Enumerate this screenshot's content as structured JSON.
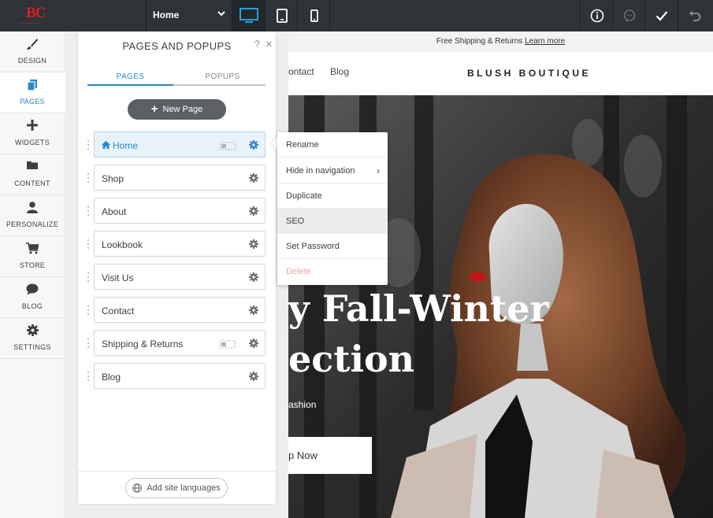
{
  "topbar": {
    "logo_text": "BC",
    "logo_sub": "BUSINESS",
    "page_selector": "Home",
    "devices": [
      "desktop-icon",
      "tablet-icon",
      "mobile-icon"
    ],
    "tools": [
      "info-icon",
      "chat-icon",
      "check-icon",
      "undo-icon"
    ]
  },
  "leftnav": {
    "items": [
      {
        "label": "DESIGN",
        "icon": "brush-icon"
      },
      {
        "label": "PAGES",
        "icon": "pages-icon"
      },
      {
        "label": "WIDGETS",
        "icon": "plus-icon"
      },
      {
        "label": "CONTENT",
        "icon": "folder-icon"
      },
      {
        "label": "PERSONALIZE",
        "icon": "person-icon"
      },
      {
        "label": "STORE",
        "icon": "cart-icon"
      },
      {
        "label": "BLOG",
        "icon": "chat-bubble-icon"
      },
      {
        "label": "SETTINGS",
        "icon": "gear-icon"
      }
    ],
    "active": "PAGES"
  },
  "panel": {
    "title": "PAGES AND POPUPS",
    "help": "?",
    "close": "×",
    "tabs": [
      {
        "label": "PAGES"
      },
      {
        "label": "POPUPS"
      }
    ],
    "new_page": "New Page",
    "pages": [
      {
        "name": "Home",
        "selected": true,
        "hidden_in_nav": true
      },
      {
        "name": "Shop"
      },
      {
        "name": "About"
      },
      {
        "name": "Lookbook"
      },
      {
        "name": "Visit Us"
      },
      {
        "name": "Contact"
      },
      {
        "name": "Shipping & Returns",
        "hidden_in_nav": true
      },
      {
        "name": "Blog"
      }
    ],
    "add_languages": "Add site languages"
  },
  "context_menu": {
    "items": [
      {
        "label": "Rename"
      },
      {
        "label": "Hide in navigation",
        "submenu": true
      },
      {
        "label": "Duplicate"
      },
      {
        "label": "SEO",
        "highlighted": true
      },
      {
        "label": "Set Password"
      },
      {
        "label": "Delete",
        "danger": true
      }
    ]
  },
  "site": {
    "promo_text": "Free Shipping & Returns",
    "promo_link": "Learn more",
    "nav": [
      "ontact",
      "Blog"
    ],
    "brand": "BLUSH BOUTIQUE",
    "hero_line1": "y Fall-Winter",
    "hero_line2": "ection",
    "hero_sub": "ashion",
    "hero_button": "p Now"
  },
  "colors": {
    "topbar": "#2e3338",
    "accent": "#2a88c8",
    "logo": "#d81f26",
    "danger": "#f0a3a3"
  }
}
